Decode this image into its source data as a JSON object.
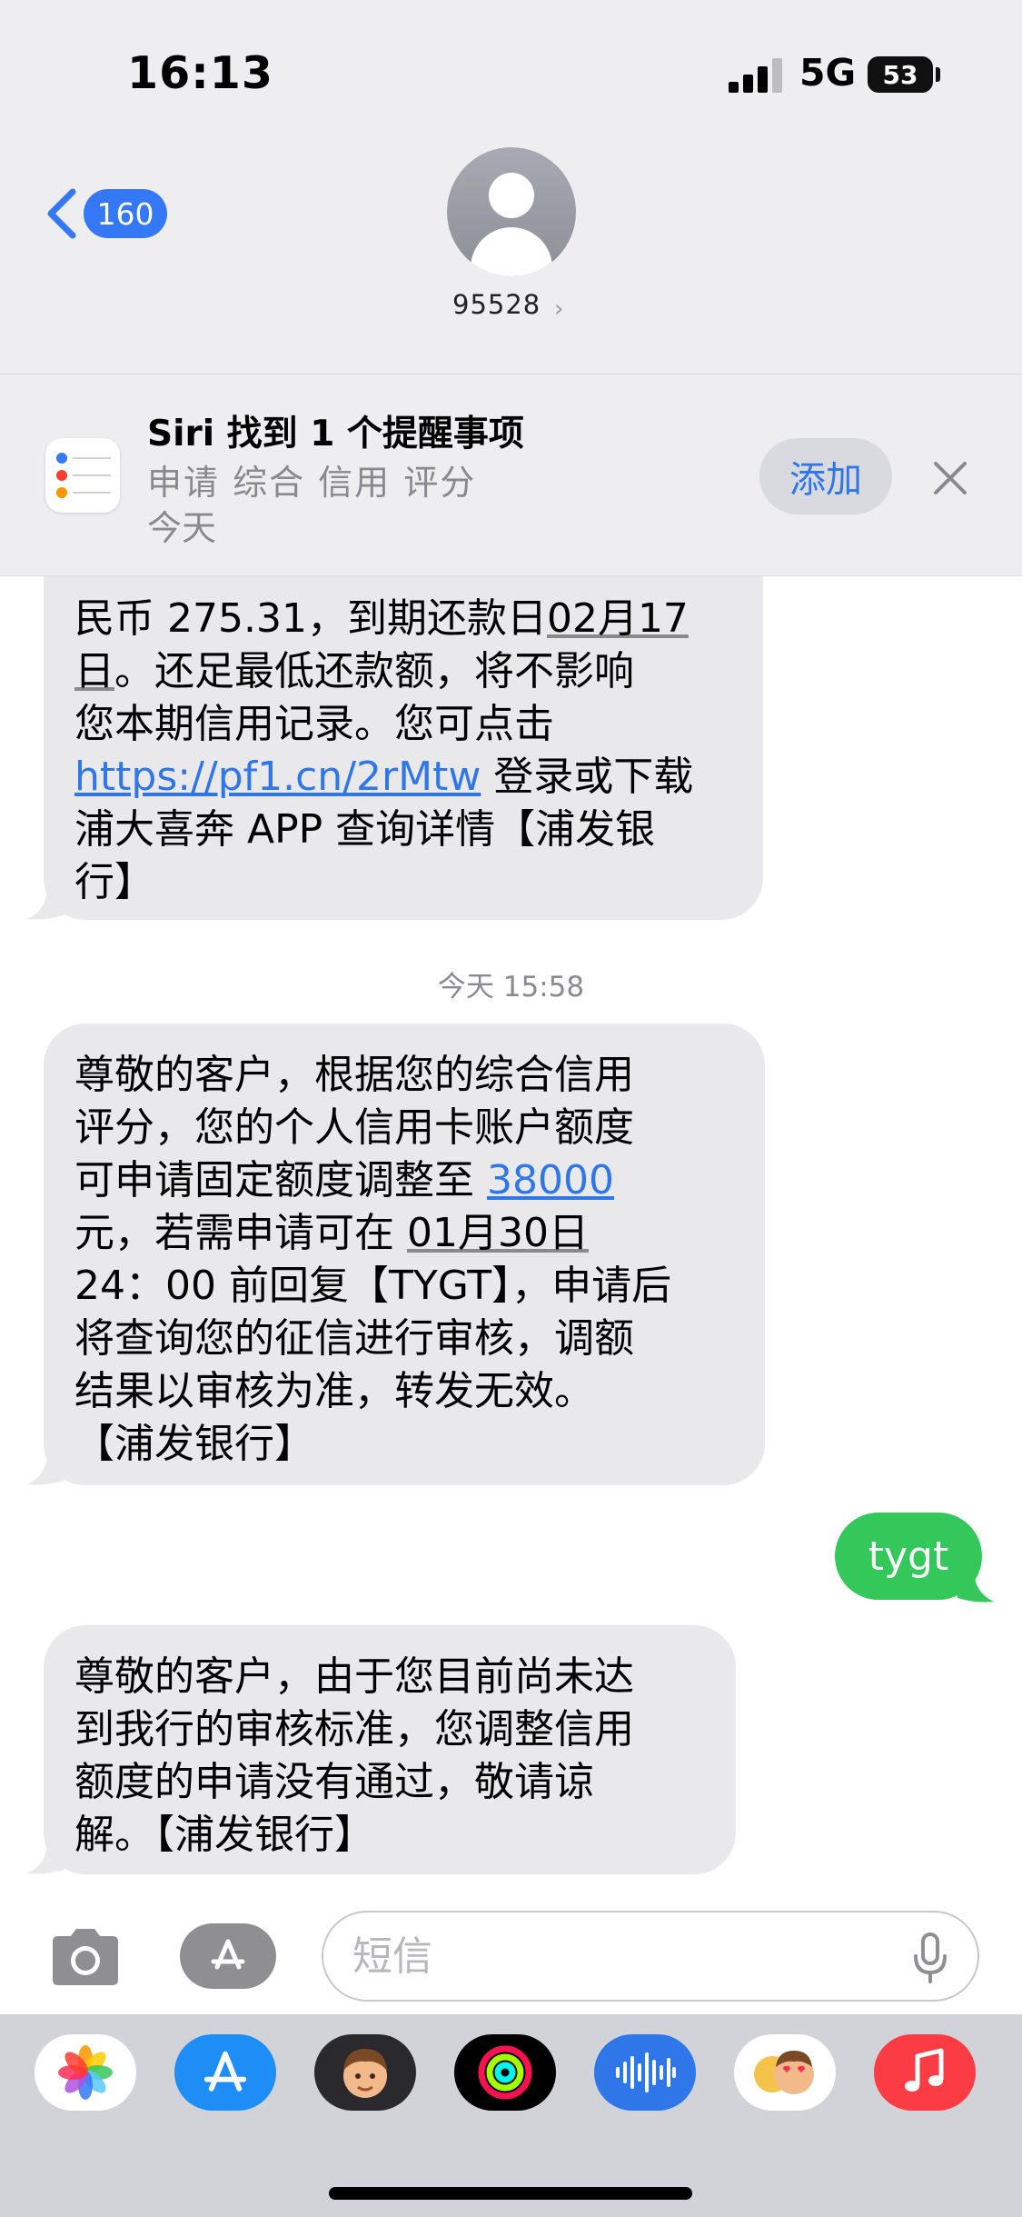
{
  "status_bar": {
    "time": "16:13",
    "network": "5G",
    "battery": "53"
  },
  "header": {
    "back_count": "160",
    "contact_name": "95528"
  },
  "siri_suggestion": {
    "title": "Siri 找到 1 个提醒事项",
    "subtitle": "申请 综合 信用 评分",
    "date": "今天",
    "add_label": "添加"
  },
  "messages": [
    {
      "direction": "incoming",
      "lines": [
        [
          "民币 275.31，到期还款日",
          "02月17"
        ],
        [
          "日",
          "。还足最低还款额，将不影响"
        ],
        [
          "您本期信用记录。您可点击"
        ],
        [
          "https://pf1.cn/2rMtw",
          " 登录或下载"
        ],
        [
          "浦大喜奔 APP 查询详情【浦发银"
        ],
        [
          "行】"
        ]
      ]
    },
    {
      "direction": "incoming",
      "lines": [
        [
          "尊敬的客户，根据您的综合信用"
        ],
        [
          "评分，您的个人信用卡账户额度"
        ],
        [
          "可申请固定额度调整至 ",
          "38000"
        ],
        [
          "元，若需申请可在 ",
          "01月30日"
        ],
        [
          "24：00 前回复【TYGT】，申请后"
        ],
        [
          "将查询您的征信进行审核，调额"
        ],
        [
          "结果以审核为准，转发无效。"
        ],
        [
          "【浦发银行】"
        ]
      ]
    },
    {
      "direction": "outgoing",
      "text": "tygt"
    },
    {
      "direction": "incoming",
      "lines": [
        [
          "尊敬的客户，由于您目前尚未达"
        ],
        [
          "到我行的审核标准，您调整信用"
        ],
        [
          "额度的申请没有通过，敬请谅"
        ],
        [
          "解。【浦发银行】"
        ]
      ]
    }
  ],
  "timestamp": "今天 15:58",
  "input": {
    "placeholder": "短信"
  },
  "app_drawer": [
    {
      "name": "photos-icon"
    },
    {
      "name": "app-store-icon"
    },
    {
      "name": "memoji-stickers-icon"
    },
    {
      "name": "activity-icon"
    },
    {
      "name": "audio-message-icon"
    },
    {
      "name": "memoji-icon"
    },
    {
      "name": "music-icon"
    }
  ],
  "colors": {
    "accent_blue": "#3478f6",
    "incoming_bubble": "#e9e9eb",
    "outgoing_bubble": "#34c759",
    "link": "#2f76e8"
  }
}
